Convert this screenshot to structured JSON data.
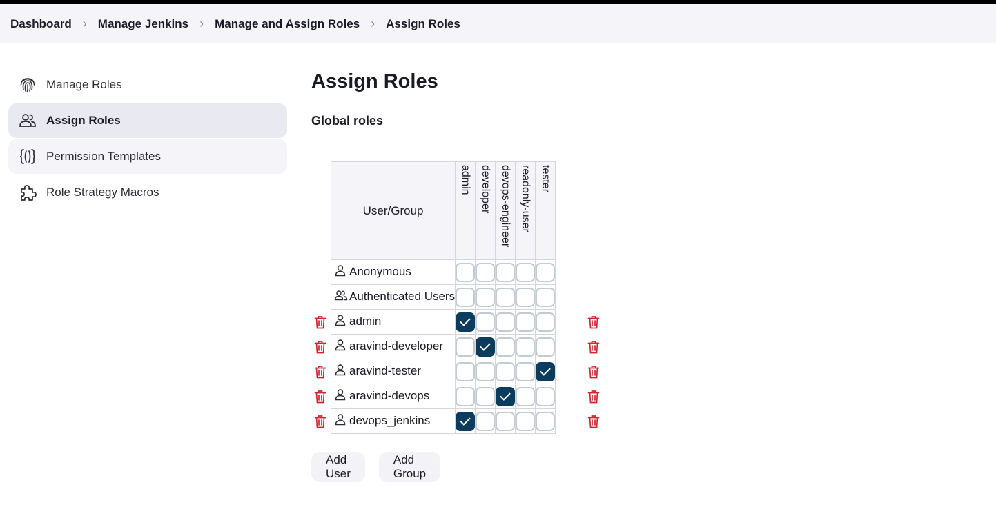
{
  "breadcrumb": [
    "Dashboard",
    "Manage Jenkins",
    "Manage and Assign Roles",
    "Assign Roles"
  ],
  "sidebar": {
    "items": [
      {
        "label": "Manage Roles",
        "icon": "fingerprint-icon"
      },
      {
        "label": "Assign Roles",
        "icon": "users-icon"
      },
      {
        "label": "Permission Templates",
        "icon": "braces-icon"
      },
      {
        "label": "Role Strategy Macros",
        "icon": "puzzle-icon"
      }
    ]
  },
  "page_title": "Assign Roles",
  "section_title": "Global roles",
  "table": {
    "header_user_group": "User/Group",
    "roles": [
      "admin",
      "developer",
      "devops-engineer",
      "readonly-user",
      "tester"
    ],
    "rows": [
      {
        "name": "Anonymous",
        "icon": "user-icon",
        "deletable": false,
        "checks": [
          false,
          false,
          false,
          false,
          false
        ]
      },
      {
        "name": "Authenticated Users",
        "icon": "group-icon",
        "deletable": false,
        "checks": [
          false,
          false,
          false,
          false,
          false
        ]
      },
      {
        "name": "admin",
        "icon": "user-icon",
        "deletable": true,
        "checks": [
          true,
          false,
          false,
          false,
          false
        ]
      },
      {
        "name": "aravind-developer",
        "icon": "user-icon",
        "deletable": true,
        "checks": [
          false,
          true,
          false,
          false,
          false
        ]
      },
      {
        "name": "aravind-tester",
        "icon": "user-icon",
        "deletable": true,
        "checks": [
          false,
          false,
          false,
          false,
          true
        ]
      },
      {
        "name": "aravind-devops",
        "icon": "user-icon",
        "deletable": true,
        "checks": [
          false,
          false,
          true,
          false,
          false
        ]
      },
      {
        "name": "devops_jenkins",
        "icon": "user-icon",
        "deletable": true,
        "checks": [
          true,
          false,
          false,
          false,
          false
        ]
      }
    ]
  },
  "buttons": {
    "add_user": "Add User",
    "add_group": "Add Group"
  },
  "colors": {
    "checked": "#0b3b5d",
    "trash": "#d0252f",
    "breadcrumb_bg": "#f5f5f9"
  }
}
